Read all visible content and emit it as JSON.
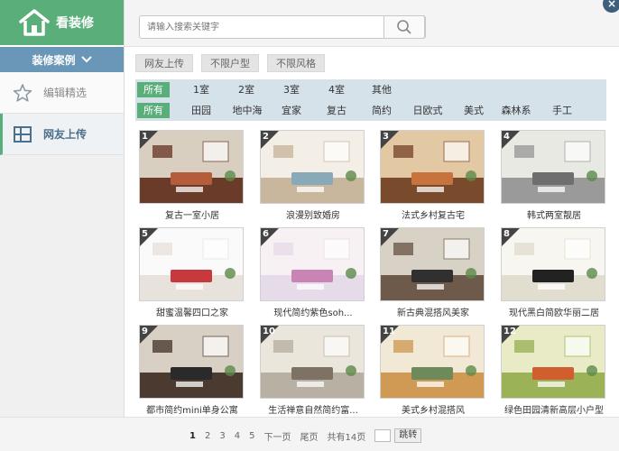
{
  "sidebar": {
    "brand": "看装修",
    "case_label": "装修案例",
    "items": [
      {
        "label": "编辑精选",
        "icon": "star-icon"
      },
      {
        "label": "网友上传",
        "icon": "layout-icon"
      }
    ]
  },
  "search": {
    "placeholder": "请输入搜索关键字"
  },
  "tags": [
    "网友上传",
    "不限户型",
    "不限风格"
  ],
  "filters": {
    "rooms": [
      "所有",
      "1室",
      "2室",
      "3室",
      "4室",
      "其他"
    ],
    "styles": [
      "所有",
      "田园",
      "地中海",
      "宜家",
      "复古",
      "简约",
      "日欧式",
      "美式",
      "森林系",
      "手工"
    ]
  },
  "cards": [
    {
      "num": "1",
      "title": "复古一室小居",
      "palette": [
        "#6b3b2a",
        "#d9cfc0",
        "#b55c3a"
      ]
    },
    {
      "num": "2",
      "title": "浪漫别致婚房",
      "palette": [
        "#c9b79d",
        "#f3efe6",
        "#87a9b8"
      ]
    },
    {
      "num": "3",
      "title": "法式乡村复古宅",
      "palette": [
        "#7a4a2c",
        "#e2c9a4",
        "#c7733e"
      ]
    },
    {
      "num": "4",
      "title": "韩式两室靓居",
      "palette": [
        "#9a9a9a",
        "#e9e9e4",
        "#6e6e6e"
      ]
    },
    {
      "num": "5",
      "title": "甜蜜温馨四口之家",
      "palette": [
        "#e8e2dc",
        "#fafafa",
        "#c8393e"
      ]
    },
    {
      "num": "6",
      "title": "现代简约紫色soh...",
      "palette": [
        "#e6dbe8",
        "#f7f1f4",
        "#c984b6"
      ]
    },
    {
      "num": "7",
      "title": "新古典混搭风美家",
      "palette": [
        "#6e5a4a",
        "#d8d2c6",
        "#303030"
      ]
    },
    {
      "num": "8",
      "title": "现代黑白简欧华丽二居",
      "palette": [
        "#e1ddcf",
        "#f7f6f0",
        "#222222"
      ]
    },
    {
      "num": "9",
      "title": "都市简约mini单身公寓",
      "palette": [
        "#4a3a30",
        "#d8d0c4",
        "#2a2a2a"
      ]
    },
    {
      "num": "10",
      "title": "生活禅意自然简约富...",
      "palette": [
        "#b8b0a2",
        "#ebe6dc",
        "#7d7264"
      ]
    },
    {
      "num": "11",
      "title": "美式乡村混搭风",
      "palette": [
        "#d09a55",
        "#f2e8d6",
        "#6e8a5a"
      ]
    },
    {
      "num": "12",
      "title": "绿色田园清新高层小户型",
      "palette": [
        "#9bb356",
        "#e8ebc6",
        "#d05e2e"
      ]
    }
  ],
  "pager": {
    "pages": [
      "1",
      "2",
      "3",
      "4",
      "5"
    ],
    "current": "1",
    "next": "下一页",
    "last": "尾页",
    "total": "共有14页",
    "jump": "跳转"
  }
}
